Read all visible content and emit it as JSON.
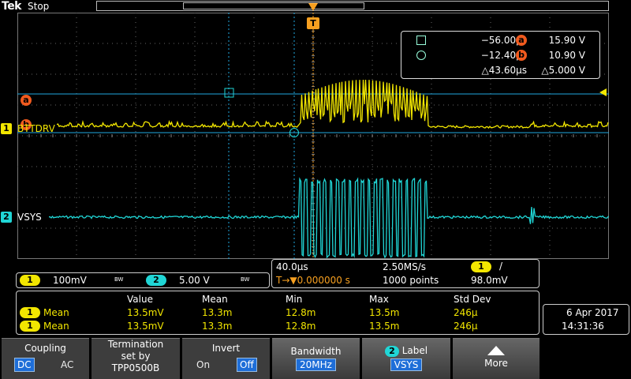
{
  "header": {
    "brand": "Tek",
    "run_status": "Stop",
    "trigger_marker": "T"
  },
  "colors": {
    "ch1": "#f2e600",
    "ch2": "#20d6d6",
    "cursor": "#f05a1e",
    "accent_blue": "#1e6ed8"
  },
  "cursors": {
    "a_marker": "a",
    "b_marker": "b",
    "readout": {
      "row1": {
        "time": "−56.00µs",
        "badge": "a",
        "volt": "15.90 V"
      },
      "row2": {
        "time": "−12.40µs",
        "badge": "b",
        "volt": "10.90 V"
      },
      "row3": {
        "time": "△43.60µs",
        "volt": "△5.000 V"
      }
    }
  },
  "channels": {
    "ch1": {
      "number": "1",
      "label": "BTTDRV"
    },
    "ch2": {
      "number": "2",
      "label": "VSYS"
    }
  },
  "scale_panel": {
    "ch1_number": "1",
    "ch1_scale": "100mV",
    "ch1_bw": "BW",
    "ch2_number": "2",
    "ch2_scale": "5.00 V",
    "ch2_bw": "BW"
  },
  "timebase": {
    "time_per_div": "40.0µs",
    "sample_rate": "2.50MS/s",
    "trigger_source": "1",
    "trigger_slope": "/",
    "trigger_position": "T→▼0.000000 s",
    "record_length": "1000 points",
    "trigger_level": "98.0mV"
  },
  "measurements": {
    "headers": [
      "Value",
      "Mean",
      "Min",
      "Max",
      "Std Dev"
    ],
    "rows": [
      {
        "channel": "1",
        "name": "Mean",
        "value": "13.5mV",
        "mean": "13.3m",
        "min": "12.8m",
        "max": "13.5m",
        "std": "246µ"
      },
      {
        "channel": "1",
        "name": "Mean",
        "value": "13.5mV",
        "mean": "13.3m",
        "min": "12.8m",
        "max": "13.5m",
        "std": "246µ"
      }
    ]
  },
  "datetime": {
    "date": "6 Apr 2017",
    "time": "14:31:36"
  },
  "menu": {
    "coupling": {
      "title": "Coupling",
      "opt1": "DC",
      "opt2": "AC"
    },
    "termination": {
      "line1": "Termination",
      "line2": "set by",
      "line3": "TPP0500B"
    },
    "invert": {
      "title": "Invert",
      "opt1": "On",
      "opt2": "Off"
    },
    "bandwidth": {
      "title": "Bandwidth",
      "value": "20MHz"
    },
    "label": {
      "channel": "2",
      "title": "Label",
      "value": "VSYS"
    },
    "more": {
      "title": "More"
    }
  }
}
